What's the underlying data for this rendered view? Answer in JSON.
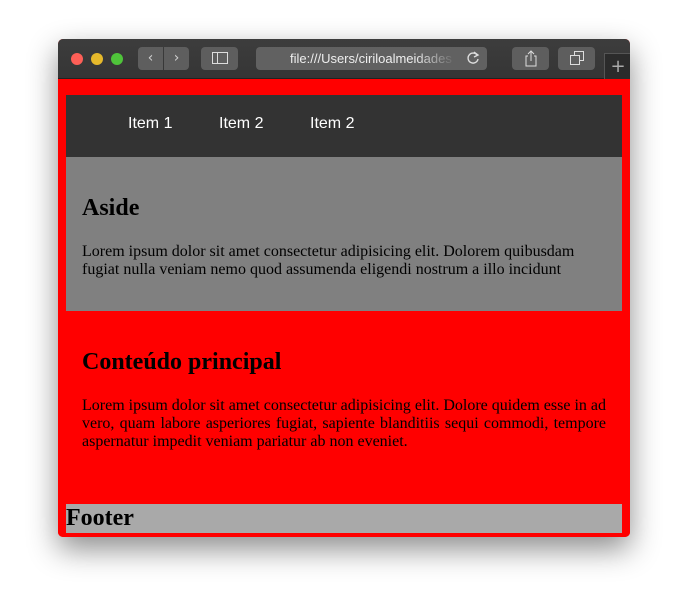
{
  "browser": {
    "url": "file:///Users/ciriloalmeidades",
    "traffic_colors": {
      "close": "#fe5f57",
      "minimize": "#febc2e",
      "zoom": "#28c840"
    },
    "back_icon": "‹",
    "forward_icon": "›",
    "new_tab_icon": "+"
  },
  "nav": {
    "items": [
      {
        "label": "Item 1"
      },
      {
        "label": "Item 2"
      },
      {
        "label": "Item 2"
      }
    ]
  },
  "aside": {
    "title": "Aside",
    "text": "Lorem ipsum dolor sit amet consectetur adipisicing elit. Dolorem quibusdam fugiat nulla veniam nemo quod assumenda eligendi nostrum a illo incidunt"
  },
  "main": {
    "title": "Conteúdo principal",
    "text": "Lorem ipsum dolor sit amet consectetur adipisicing elit. Dolore quidem esse in ad vero, quam labore asperiores fugiat, sapiente blanditiis sequi commodi, tempore aspernatur impedit veniam pariatur ab non eveniet."
  },
  "footer": {
    "title": "Footer"
  }
}
